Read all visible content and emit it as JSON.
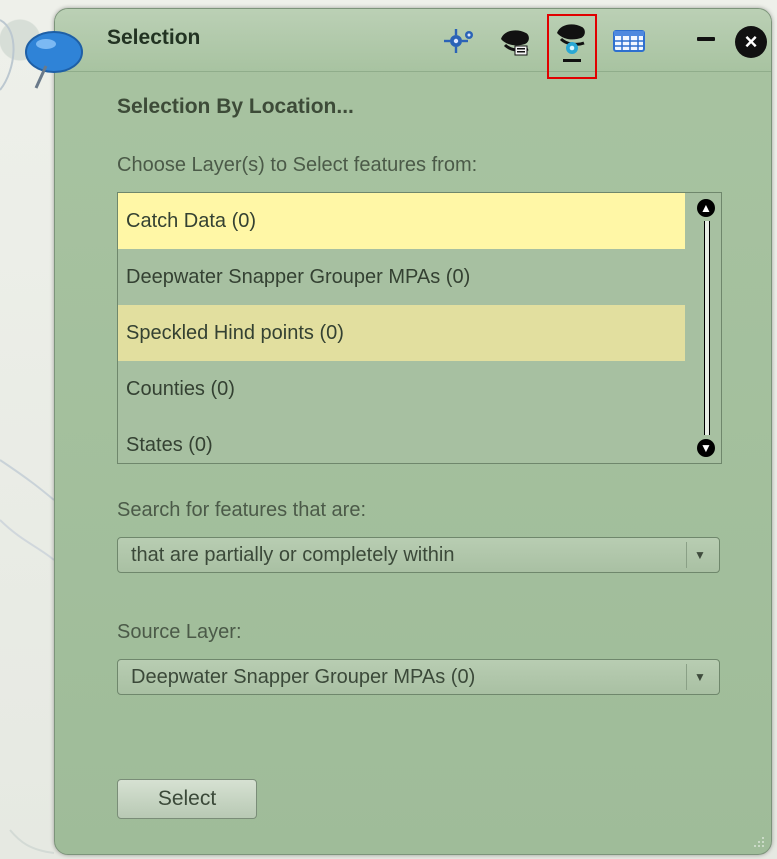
{
  "window": {
    "title": "Selection"
  },
  "toolbar": {
    "icons": [
      "select-features-icon",
      "select-by-attribute-icon",
      "select-by-location-icon",
      "table-icon"
    ],
    "active_icon": "select-by-location-icon"
  },
  "selection_panel": {
    "heading": "Selection By Location...",
    "choose_layers_label": "Choose Layer(s) to Select features from:",
    "layers": [
      {
        "label": "Catch Data (0)",
        "state": "highlighted"
      },
      {
        "label": "Deepwater Snapper Grouper MPAs (0)",
        "state": "normal"
      },
      {
        "label": "Speckled Hind points (0)",
        "state": "selected"
      },
      {
        "label": "Counties (0)",
        "state": "normal"
      },
      {
        "label": "States (0)",
        "state": "normal"
      }
    ],
    "search_label": "Search for features that are:",
    "search_value": "that are partially or completely within",
    "source_label": "Source Layer:",
    "source_value": "Deepwater Snapper Grouper MPAs (0)",
    "select_button": "Select"
  },
  "colors": {
    "panel_bg": "#a8c3a1",
    "highlight_yellow": "#fff7a6",
    "selected_yellow": "#e2df9f",
    "active_outline": "#e10000"
  }
}
